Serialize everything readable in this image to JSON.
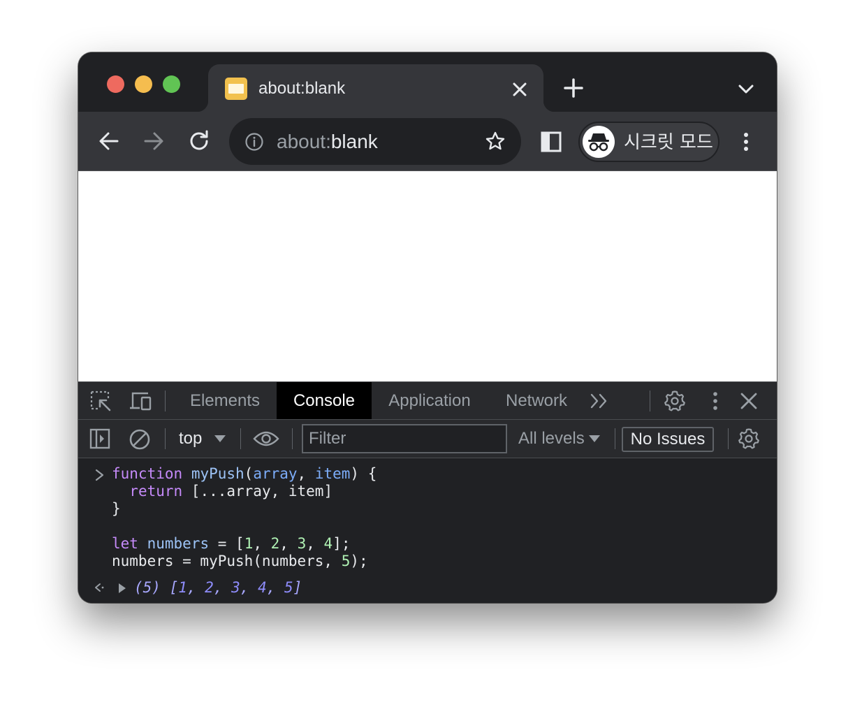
{
  "tab": {
    "title": "about:blank"
  },
  "omnibox": {
    "scheme": "about:",
    "path": "blank"
  },
  "profile": {
    "label": "시크릿 모드"
  },
  "devtools": {
    "tabs": [
      "Elements",
      "Console",
      "Application",
      "Network"
    ],
    "active_tab": "Console",
    "context": "top",
    "filter_placeholder": "Filter",
    "levels": "All levels",
    "issues": "No Issues"
  },
  "console": {
    "input_lines": [
      "function myPush(array, item) {",
      "  return [...array, item]",
      "}",
      "",
      "let numbers = [1, 2, 3, 4];",
      "numbers = myPush(numbers, 5);"
    ],
    "output": "(5) [1, 2, 3, 4, 5]"
  },
  "colors": {
    "traffic_red": "#ee6a5f",
    "traffic_yellow": "#f5bd4f",
    "traffic_green": "#61c454",
    "keyword": "#c58af9",
    "number": "#b0f2b4"
  },
  "icons": [
    "back-arrow-icon",
    "forward-arrow-icon",
    "reload-icon",
    "info-icon",
    "star-icon",
    "side-panel-icon",
    "incognito-icon",
    "kebab-menu-icon",
    "inspect-element-icon",
    "device-toolbar-icon",
    "more-tabs-icon",
    "settings-gear-icon",
    "close-icon",
    "sidebar-toggle-icon",
    "clear-console-icon",
    "eye-icon",
    "caret-down-icon"
  ]
}
